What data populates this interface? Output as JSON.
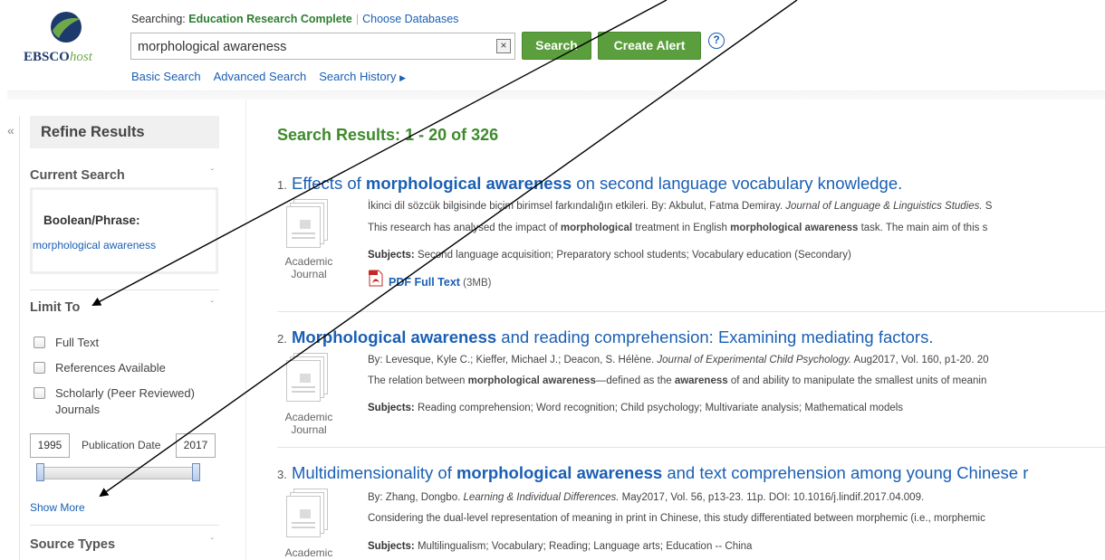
{
  "header": {
    "logo_brand": "EBSCO",
    "logo_suffix": "host",
    "searching_prefix": "Searching: ",
    "database": "Education Research Complete",
    "choose_databases": "Choose Databases",
    "search_value": "morphological awareness",
    "clear_glyph": "×",
    "search_button": "Search",
    "create_alert_button": "Create Alert",
    "help_glyph": "?",
    "nav": [
      "Basic Search",
      "Advanced Search",
      "Search History"
    ]
  },
  "sidebar": {
    "collapse_glyph": "«",
    "refine_title": "Refine Results",
    "current_search": "Current Search",
    "boolean_label": "Boolean/Phrase:",
    "boolean_value": "morphological awareness",
    "limit_to": "Limit To",
    "limits": [
      "Full Text",
      "References Available",
      "Scholarly (Peer Reviewed)",
      "Journals"
    ],
    "date_from": "1995",
    "date_label": "Publication Date",
    "date_to": "2017",
    "show_more": "Show More",
    "source_types": "Source Types",
    "chevron_glyph": "ˇ"
  },
  "results": {
    "heading_prefix": "Search Results: ",
    "heading_range": "1 - 20 of 326",
    "items": [
      {
        "num": "1.",
        "title_pre": "Effects of ",
        "title_bold": "morphological awareness",
        "title_post": " on second language vocabulary knowledge.",
        "line1_pre": "İkinci dil sözcük bilgisinde biçim birimsel farkındalığın etkileri. By: Akbulut, Fatma Demiray. ",
        "line1_italic": "Journal of Language & Linguistics Studies.",
        "line1_post": " S",
        "line2_a": "This research has analysed the impact of ",
        "line2_b": "morphological",
        "line2_c": " treatment in English ",
        "line2_d": "morphological awareness",
        "line2_e": " task. The main aim of this s",
        "subjects_label": "Subjects:",
        "subjects": " Second language acquisition; Preparatory school students; Vocabulary education (Secondary)",
        "type_1": "Academic",
        "type_2": "Journal",
        "pdf_link": "PDF Full Text",
        "pdf_size": " (3MB)"
      },
      {
        "num": "2.",
        "title_bold": "Morphological awareness",
        "title_post": " and reading comprehension: Examining mediating factors.",
        "line1_pre": "By: Levesque, Kyle C.; Kieffer, Michael J.; Deacon, S. Hélène. ",
        "line1_italic": "Journal of Experimental Child Psychology.",
        "line1_post": " Aug2017, Vol. 160, p1-20. 20",
        "line2_a": "The relation between ",
        "line2_b": "morphological awareness",
        "line2_c": "—defined as the ",
        "line2_d": "awareness",
        "line2_e": " of and ability to manipulate the smallest units of meanin",
        "subjects_label": "Subjects:",
        "subjects": " Reading comprehension; Word recognition; Child psychology; Multivariate analysis; Mathematical models",
        "type_1": "Academic",
        "type_2": "Journal"
      },
      {
        "num": "3.",
        "title_pre": "Multidimensionality of ",
        "title_bold": "morphological awareness",
        "title_post": " and text comprehension among young Chinese r",
        "line1_pre": "By: Zhang, Dongbo. ",
        "line1_italic": "Learning & Individual Differences.",
        "line1_post": " May2017, Vol. 56, p13-23. 11p. DOI: 10.1016/j.lindif.2017.04.009.",
        "line2_a": "Considering the dual-level representation of meaning in print in Chinese, this study differentiated between morphemic (i.e., morphemic",
        "subjects_label": "Subjects:",
        "subjects": " Multilingualism; Vocabulary; Reading; Language arts; Education -- China",
        "type_1": "Academic"
      }
    ]
  },
  "colors": {
    "link_blue": "#1a5fb4",
    "brand_green": "#5b9e3d",
    "heading_green": "#3e8a2b",
    "pdf_red": "#d32f2f"
  }
}
